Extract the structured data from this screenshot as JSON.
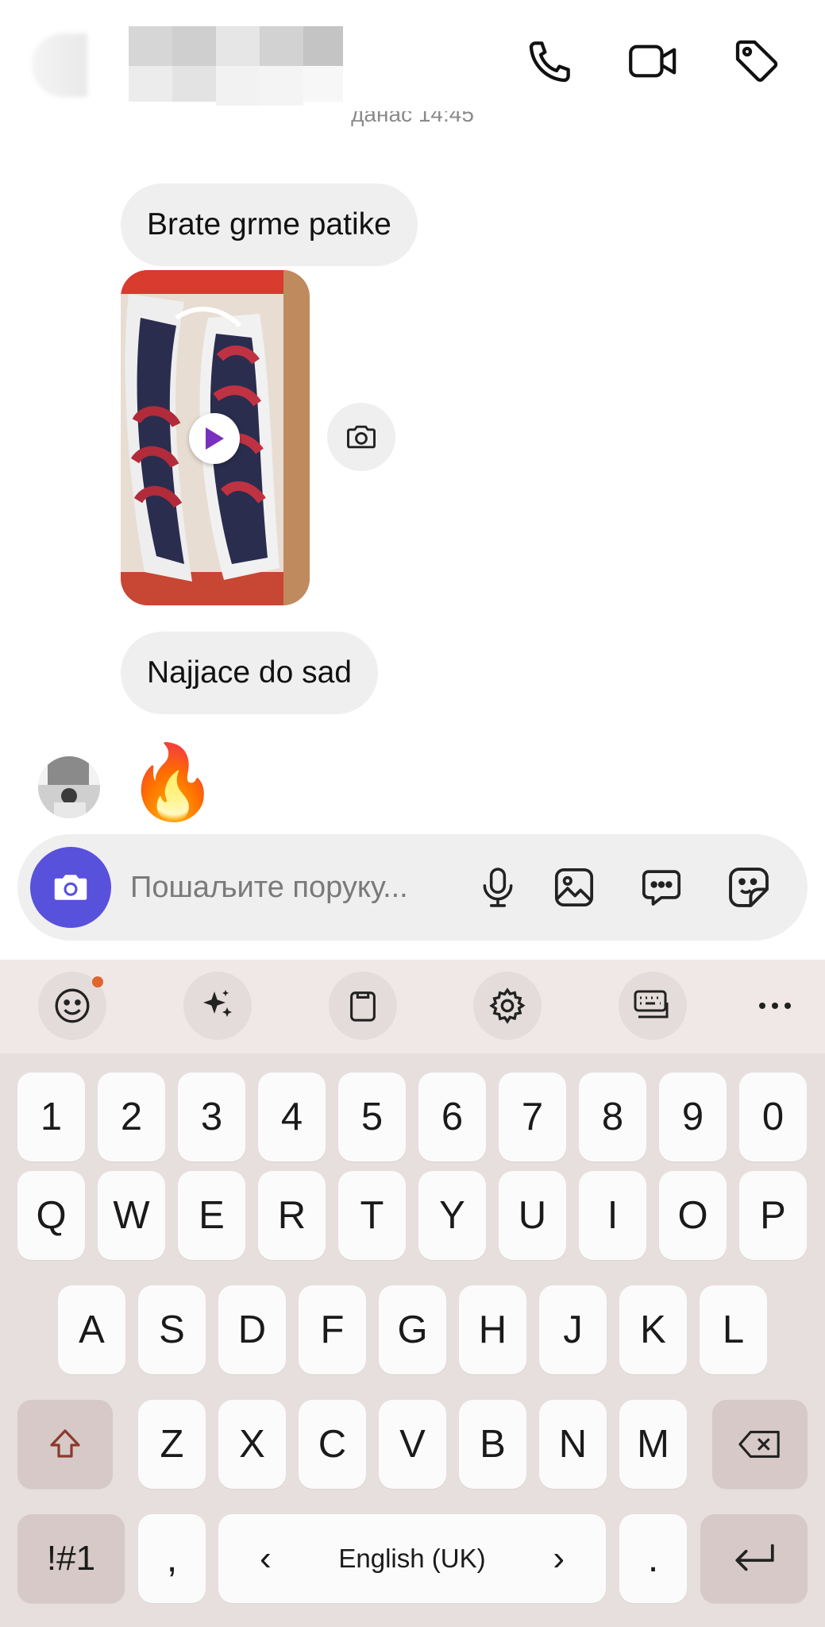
{
  "header": {
    "date_label": "данас 14:45",
    "icons": [
      "phone-icon",
      "video-icon",
      "tag-icon"
    ]
  },
  "messages": {
    "msg1": "Brate grme patike",
    "msg2": "Najjace do sad",
    "reaction": "🔥"
  },
  "composer": {
    "placeholder": "Пошаљите поруку..."
  },
  "keyboard": {
    "toolbar": [
      "emoji-icon",
      "ai-sparkle-icon",
      "clipboard-icon",
      "settings-icon",
      "keyboard-mode-icon",
      "more-icon"
    ],
    "row_numbers": [
      "1",
      "2",
      "3",
      "4",
      "5",
      "6",
      "7",
      "8",
      "9",
      "0"
    ],
    "row_q": [
      "Q",
      "W",
      "E",
      "R",
      "T",
      "Y",
      "U",
      "I",
      "O",
      "P"
    ],
    "row_a": [
      "A",
      "S",
      "D",
      "F",
      "G",
      "H",
      "J",
      "K",
      "L"
    ],
    "row_z": [
      "Z",
      "X",
      "C",
      "V",
      "B",
      "N",
      "M"
    ],
    "symbols_label": "!#1",
    "comma": ",",
    "period": ".",
    "space_label": "English (UK)",
    "space_left": "‹",
    "space_right": "›"
  }
}
